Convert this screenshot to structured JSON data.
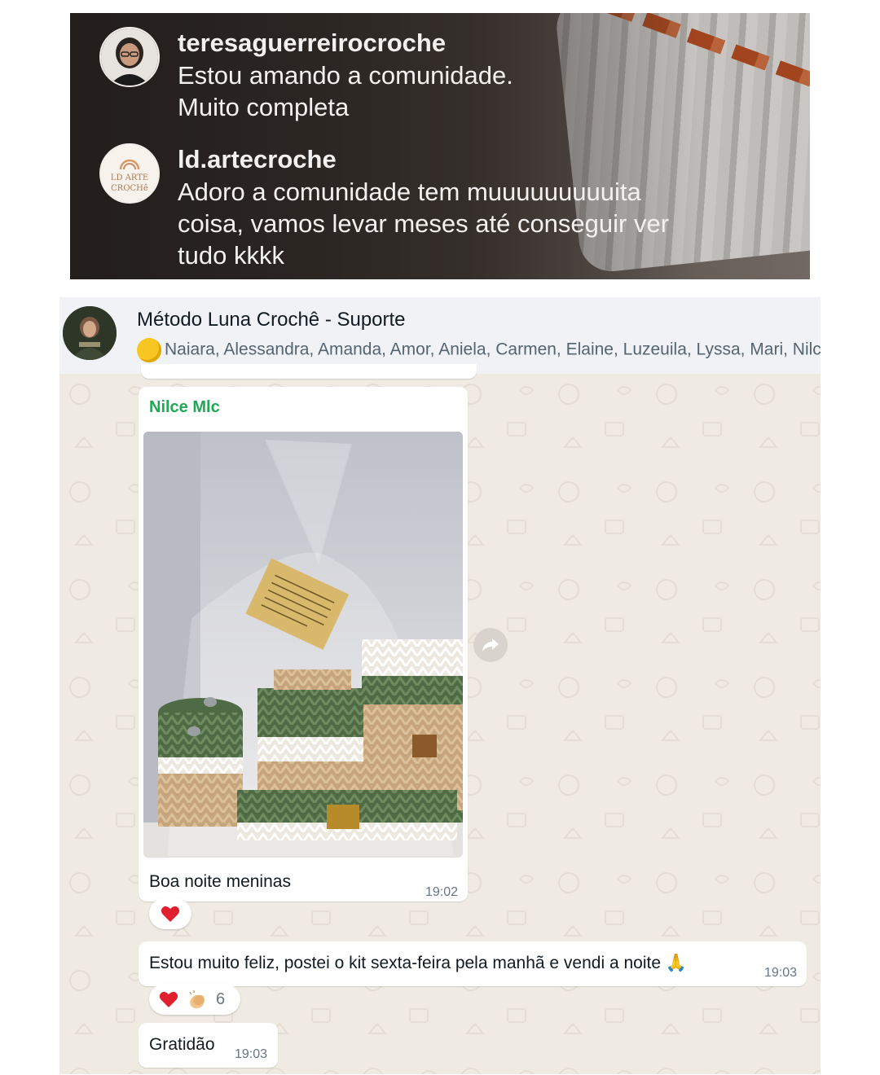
{
  "instagram": {
    "comments": [
      {
        "username": "teresaguerreirocroche",
        "text_line1": "Estou amando a comunidade.",
        "text_line2": "Muito completa"
      },
      {
        "username": "ld.artecroche",
        "avatar_text_line1": "LD ARTE",
        "avatar_text_line2": "CROCHê",
        "text_line1": "Adoro a comunidade tem muuuuuuuuuita",
        "text_line2": "coisa, vamos levar meses até conseguir ver",
        "text_line3": "tudo kkkk"
      }
    ]
  },
  "chat": {
    "header": {
      "title": "Método Luna Crochê - Suporte",
      "members": "Naiara, Alessandra, Amanda, Amor, Aniela, Carmen, Elaine, Luzeuila, Lyssa, Mari, Nilce,"
    },
    "messages": [
      {
        "sender": "Nilce Mlc",
        "caption": "Boa noite meninas",
        "time": "19:02",
        "reactions": {
          "icons": [
            "heart-icon"
          ]
        }
      },
      {
        "text": "Estou muito feliz, postei o kit sexta-feira pela manhã e vendi a noite 🙏",
        "time": "19:03",
        "reactions": {
          "icons": [
            "heart-icon",
            "clapping-hands-icon"
          ],
          "count": "6"
        }
      },
      {
        "text": "Gratidão",
        "time": "19:03"
      }
    ]
  },
  "colors": {
    "sender_name": "#1fa855",
    "chat_background": "#efeae2",
    "header_background": "#f0f2f5",
    "heart": "#e0202c"
  }
}
